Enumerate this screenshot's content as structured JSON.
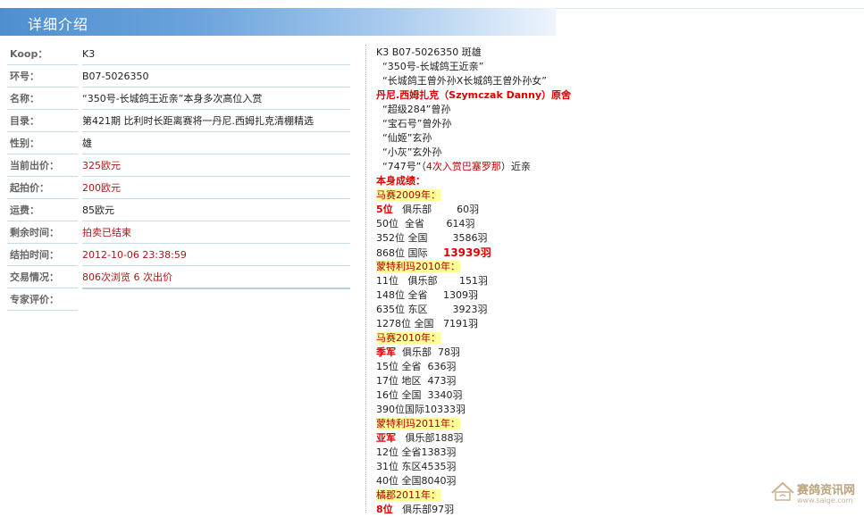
{
  "header": {
    "title": "详细介绍"
  },
  "info": [
    {
      "label": "Koop：",
      "value": "K3",
      "red": false
    },
    {
      "label": "环号：",
      "value": "B07-5026350",
      "red": false
    },
    {
      "label": "名称：",
      "value": "“350号-长城鸽王近亲”本身多次高位入赏",
      "red": false
    },
    {
      "label": "目录：",
      "value": "第421期 比利时长距离赛将一丹尼.西姆扎克清棚精选",
      "red": false
    },
    {
      "label": "性别：",
      "value": "雄",
      "red": false
    },
    {
      "label": "当前出价：",
      "value": "325欧元",
      "red": true
    },
    {
      "label": "起拍价：",
      "value": "200欧元",
      "red": true
    },
    {
      "label": "运费：",
      "value": "85欧元",
      "red": false
    },
    {
      "label": "剩余时间：",
      "value": "拍卖已结束",
      "red": true
    },
    {
      "label": "结拍时间：",
      "value": "2012-10-06  23:38:59",
      "red": true
    },
    {
      "label": "交易情况：",
      "value": "806次浏览   6 次出价",
      "red": true
    },
    {
      "label": "专家评价：",
      "value": "",
      "red": false
    }
  ],
  "description": {
    "intro": [
      "K3 B07-5026350 斑雄",
      "  “350号-长城鸽王近亲”",
      "  “长城鸽王曾外孙X长城鸽王曾外孙女”"
    ],
    "breeder_line": "丹尼.西姆扎克（Szymczak Danny）原舍",
    "relations": [
      "  “超级284”曾孙",
      "  “宝石号”曾外孙",
      "  “仙姬”玄孙",
      "  “小灰”玄外孙"
    ],
    "relation_747": {
      "prefix": "  “747号”（",
      "red": "4次入赏巴塞罗那",
      "suffix": "）近亲"
    },
    "results_title": "本身成绩：",
    "seasons": [
      {
        "title": "马赛2009年：",
        "rows": [
          {
            "pos": "5位",
            "text": "   俱乐部        60羽",
            "boldpos": true,
            "bigtail": ""
          },
          {
            "pos": "50位",
            "text": "  全省       614羽",
            "boldpos": false,
            "bigtail": ""
          },
          {
            "pos": "352位",
            "text": " 全国        3586羽",
            "boldpos": false,
            "bigtail": ""
          },
          {
            "pos": "868位",
            "text": " 国际     ",
            "boldpos": false,
            "bigtail": "13939羽"
          }
        ]
      },
      {
        "title": "蒙特利玛2010年：",
        "rows": [
          {
            "pos": "11位",
            "text": "   俱乐部       151羽",
            "boldpos": false,
            "bigtail": ""
          },
          {
            "pos": "148位",
            "text": " 全省     1309羽",
            "boldpos": false,
            "bigtail": ""
          },
          {
            "pos": "635位",
            "text": " 东区        3923羽",
            "boldpos": false,
            "bigtail": ""
          },
          {
            "pos": "1278位",
            "text": " 全国   7191羽",
            "boldpos": false,
            "bigtail": ""
          }
        ]
      },
      {
        "title": "马赛2010年：",
        "rows": [
          {
            "pos": "季军",
            "text": "  俱乐部  78羽",
            "boldpos": true,
            "bigtail": ""
          },
          {
            "pos": "15位",
            "text": " 全省  636羽",
            "boldpos": false,
            "bigtail": ""
          },
          {
            "pos": "17位",
            "text": " 地区  473羽",
            "boldpos": false,
            "bigtail": ""
          },
          {
            "pos": "16位",
            "text": " 全国  3340羽",
            "boldpos": false,
            "bigtail": ""
          },
          {
            "pos": "390位",
            "text": "国际10333羽",
            "boldpos": false,
            "bigtail": ""
          }
        ]
      },
      {
        "title": "蒙特利玛2011年：",
        "rows": [
          {
            "pos": "亚军",
            "text": "   俱乐部188羽",
            "boldpos": true,
            "bigtail": ""
          },
          {
            "pos": "12位",
            "text": " 全省1383羽",
            "boldpos": false,
            "bigtail": ""
          },
          {
            "pos": "31位",
            "text": " 东区4535羽",
            "boldpos": false,
            "bigtail": ""
          },
          {
            "pos": "40位",
            "text": " 全国8040羽",
            "boldpos": false,
            "bigtail": ""
          }
        ]
      },
      {
        "title": "橘郡2011年：",
        "rows": [
          {
            "pos": "8位",
            "text": "   俱乐部97羽",
            "boldpos": true,
            "bigtail": ""
          }
        ]
      }
    ]
  },
  "watermark": {
    "title": "赛鸽资讯网",
    "url": "www.saige.com"
  }
}
